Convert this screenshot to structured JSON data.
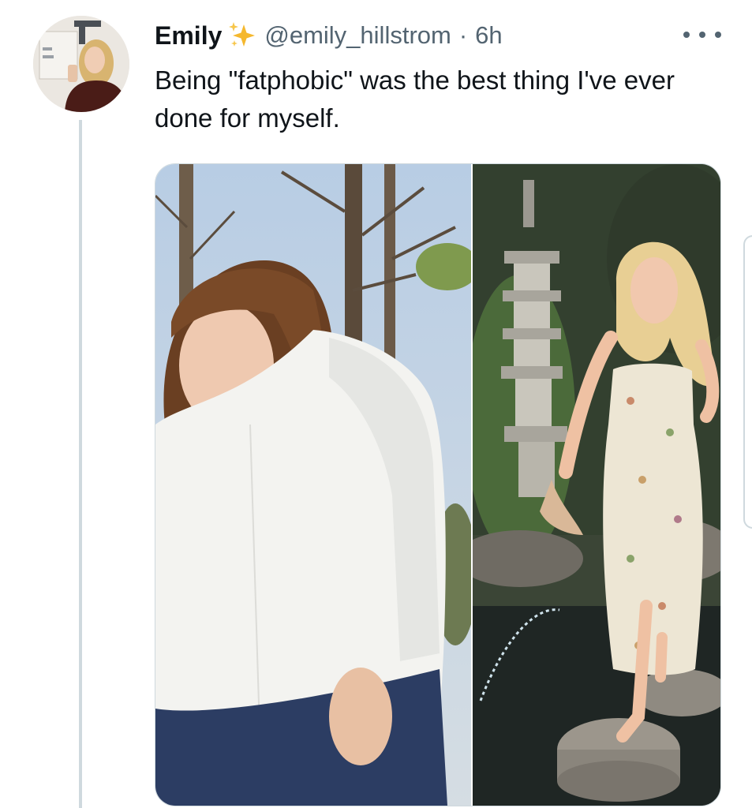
{
  "tweet": {
    "display_name": "Emily",
    "handle": "@emily_hillstrom",
    "separator": "·",
    "time_ago": "6h",
    "text": "Being \"fatphobic\" was the best thing I've ever done for myself.",
    "avatar_icon": "user-avatar",
    "badge_icon": "sparkles-icon",
    "menu_icon": "more-options-icon"
  },
  "media": {
    "photo_count": 2
  },
  "colors": {
    "text_primary": "#0f1419",
    "text_secondary": "#536471",
    "border": "#cfd9de",
    "sparkle": "#f5b82e"
  }
}
